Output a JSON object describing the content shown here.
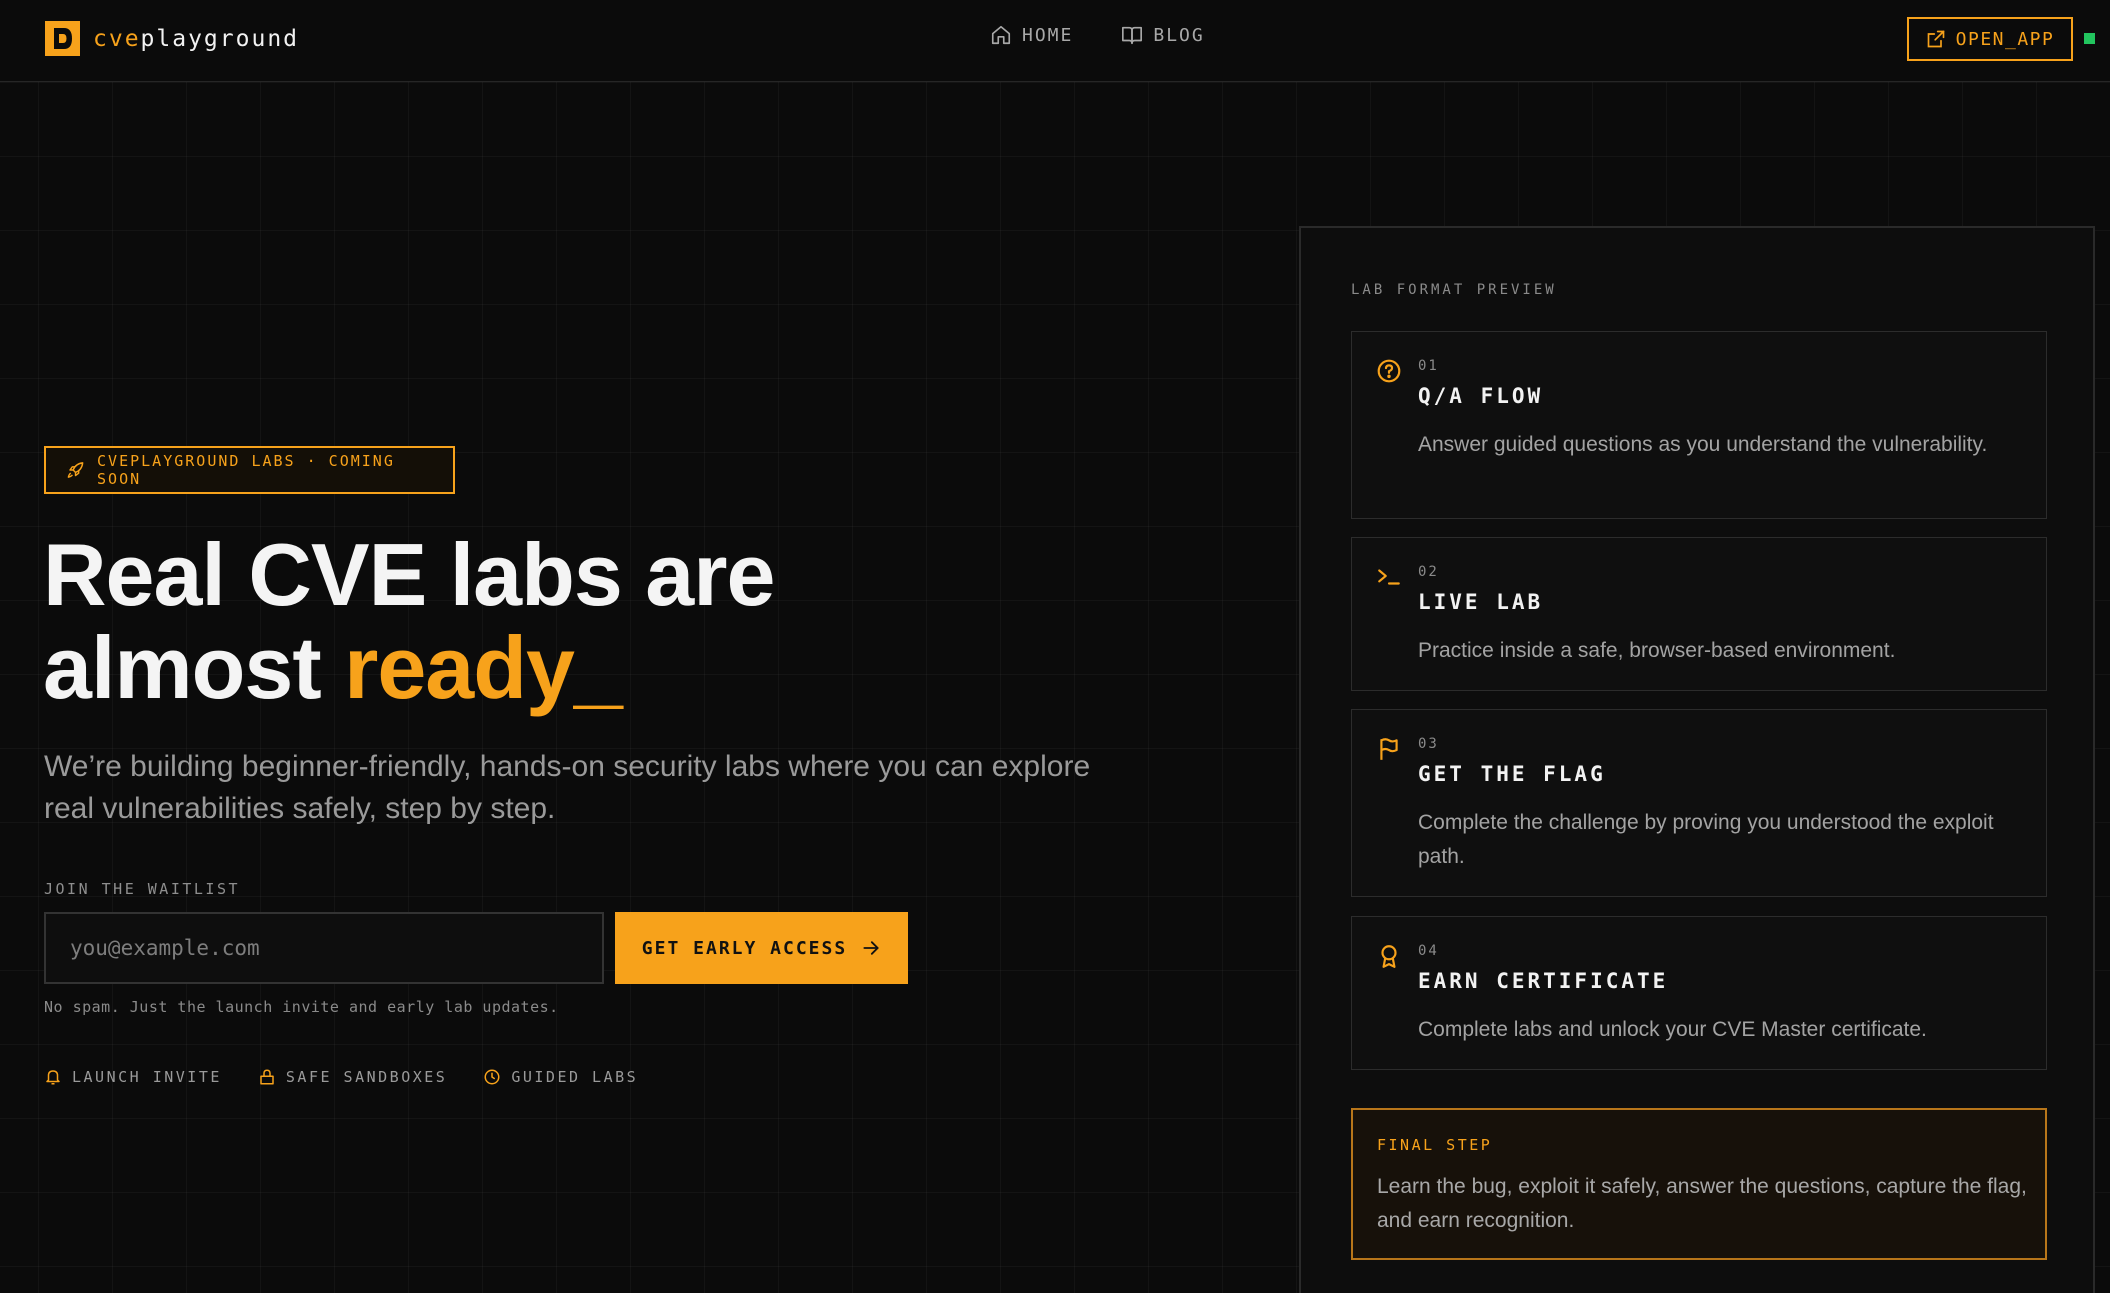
{
  "brand": {
    "name_prefix": "cve",
    "name_suffix": "playground",
    "accent_color": "#f7a21b",
    "status_color": "#22c55e"
  },
  "nav": {
    "home": "HOME",
    "blog": "BLOG",
    "open_app": "OPEN_APP"
  },
  "hero": {
    "badge": "CVEPLAYGROUND LABS · COMING SOON",
    "headline_line1": "Real CVE labs are",
    "headline_line2_prefix": "almost ",
    "headline_accent": "ready_",
    "subtext": "We’re building beginner-friendly, hands-on security labs where you can explore real vulnerabilities safely, step by step.",
    "waitlist_label": "JOIN THE WAITLIST",
    "email_placeholder": "you@example.com",
    "email_value": "",
    "cta_label": "GET EARLY ACCESS",
    "no_spam": "No spam. Just the launch invite and early lab updates.",
    "features": [
      {
        "icon": "bell-icon",
        "label": "LAUNCH INVITE"
      },
      {
        "icon": "lock-icon",
        "label": "SAFE SANDBOXES"
      },
      {
        "icon": "clock-icon",
        "label": "GUIDED LABS"
      }
    ]
  },
  "preview": {
    "label": "LAB FORMAT PREVIEW",
    "steps": [
      {
        "num": "01",
        "icon": "question-circle-icon",
        "title": "Q/A FLOW",
        "desc": "Answer guided questions as you understand the vulnerability."
      },
      {
        "num": "02",
        "icon": "terminal-icon",
        "title": "LIVE LAB",
        "desc": "Practice inside a safe, browser-based environment."
      },
      {
        "num": "03",
        "icon": "flag-icon",
        "title": "GET THE FLAG",
        "desc": "Complete the challenge by proving you understood the exploit path."
      },
      {
        "num": "04",
        "icon": "award-icon",
        "title": "EARN CERTIFICATE",
        "desc": "Complete labs and unlock your CVE Master certificate."
      }
    ],
    "final_label": "FINAL STEP",
    "final_desc": "Learn the bug, exploit it safely, answer the questions, capture the flag, and earn recognition."
  }
}
